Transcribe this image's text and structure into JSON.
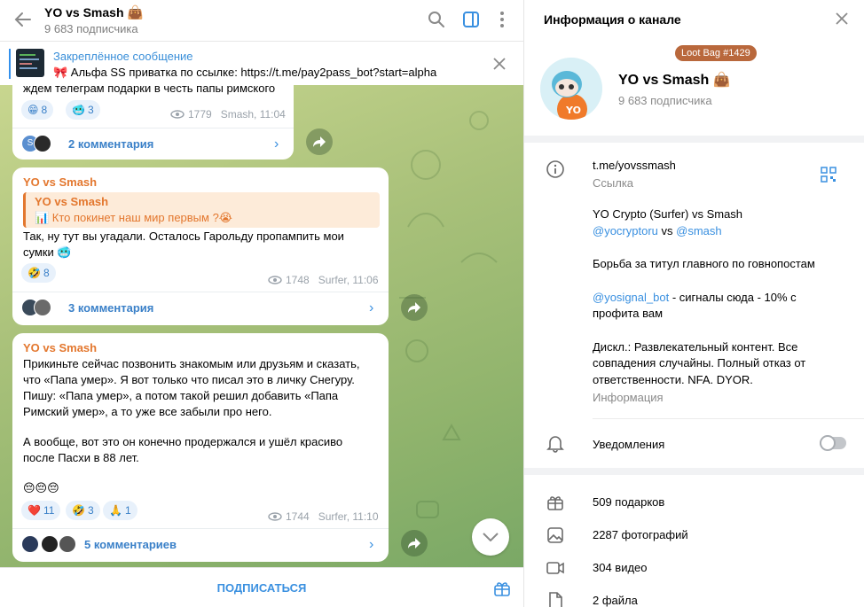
{
  "header": {
    "title": "YO vs Smash",
    "subscribers": "9 683 подписчика"
  },
  "pinned": {
    "title": "Закреплённое сообщение",
    "text": "🎀 Альфа SS приватка по ссылке: https://t.me/pay2pass_bot?start=alpha"
  },
  "messages": [
    {
      "text": "ждем телеграм подарки в честь папы римского",
      "reactions": [
        {
          "emoji": "😁",
          "count": "8"
        },
        {
          "emoji": "🥶",
          "count": "3"
        }
      ],
      "views": "1779",
      "author_time": "Smash, 11:04",
      "comments": "2 комментария"
    },
    {
      "name": "YO vs Smash",
      "quote_name": "YO vs Smash",
      "quote_text": "📊 Кто покинет наш мир первым ?😭",
      "text_line1": "Так, ну тут вы угадали. Осталось Гарольду пропампить мои",
      "text_line2": "сумки 🥶",
      "reactions": [
        {
          "emoji": "🤣",
          "count": "8"
        }
      ],
      "views": "1748",
      "author_time": "Surfer, 11:06",
      "comments": "3 комментария"
    },
    {
      "name": "YO vs Smash",
      "lines": [
        "Прикиньте сейчас позвонить знакомым или друзьям и сказать,",
        "что «Папа умер». Я вот только что писал это в личку Снегуру.",
        "Пишу: «Папа умер», а потом такой решил добавить «Папа",
        "Римский умер», а то уже все забыли про него.",
        "",
        "А вообще, вот это он конечно продержался и ушёл красиво",
        "после Пасхи в 88 лет.",
        "",
        "😔😔😔"
      ],
      "reactions": [
        {
          "emoji": "❤️",
          "count": "11"
        },
        {
          "emoji": "🤣",
          "count": "3"
        },
        {
          "emoji": "🙏",
          "count": "1"
        }
      ],
      "views": "1744",
      "author_time": "Surfer, 11:10",
      "comments": "5 комментариев"
    }
  ],
  "bottom": {
    "subscribe": "ПОДПИСАТЬСЯ"
  },
  "info": {
    "title": "Информация о канале",
    "loot_badge": "Loot Bag #1429",
    "name": "YO vs Smash",
    "subscribers": "9 683 подписчика",
    "link": "t.me/yovssmash",
    "link_label": "Ссылка",
    "desc_line1": "YO Crypto (Surfer) vs Smash",
    "desc_mention1": "@yocryptoru",
    "desc_vs": " vs ",
    "desc_mention2": "@smash",
    "desc_line3": "Борьба за титул главного по говнопостам",
    "desc_mention3": "@yosignal_bot",
    "desc_signal": " - сигналы сюда - 10% с",
    "desc_signal2": "профита вам",
    "desc_disc1": "Дискл.: Развлекательный контент. Все",
    "desc_disc2": "совпадения случайны. Полный отказ от",
    "desc_disc3": "ответственности. NFA. DYOR.",
    "desc_label": "Информация",
    "notifications": "Уведомления",
    "gifts": "509 подарков",
    "photos": "2287 фотографий",
    "videos": "304 видео",
    "files": "2 файла"
  },
  "colors": {
    "accent": "#3a90e0",
    "channel_name": "#e3772e",
    "loot_badge": "#b9683c"
  }
}
